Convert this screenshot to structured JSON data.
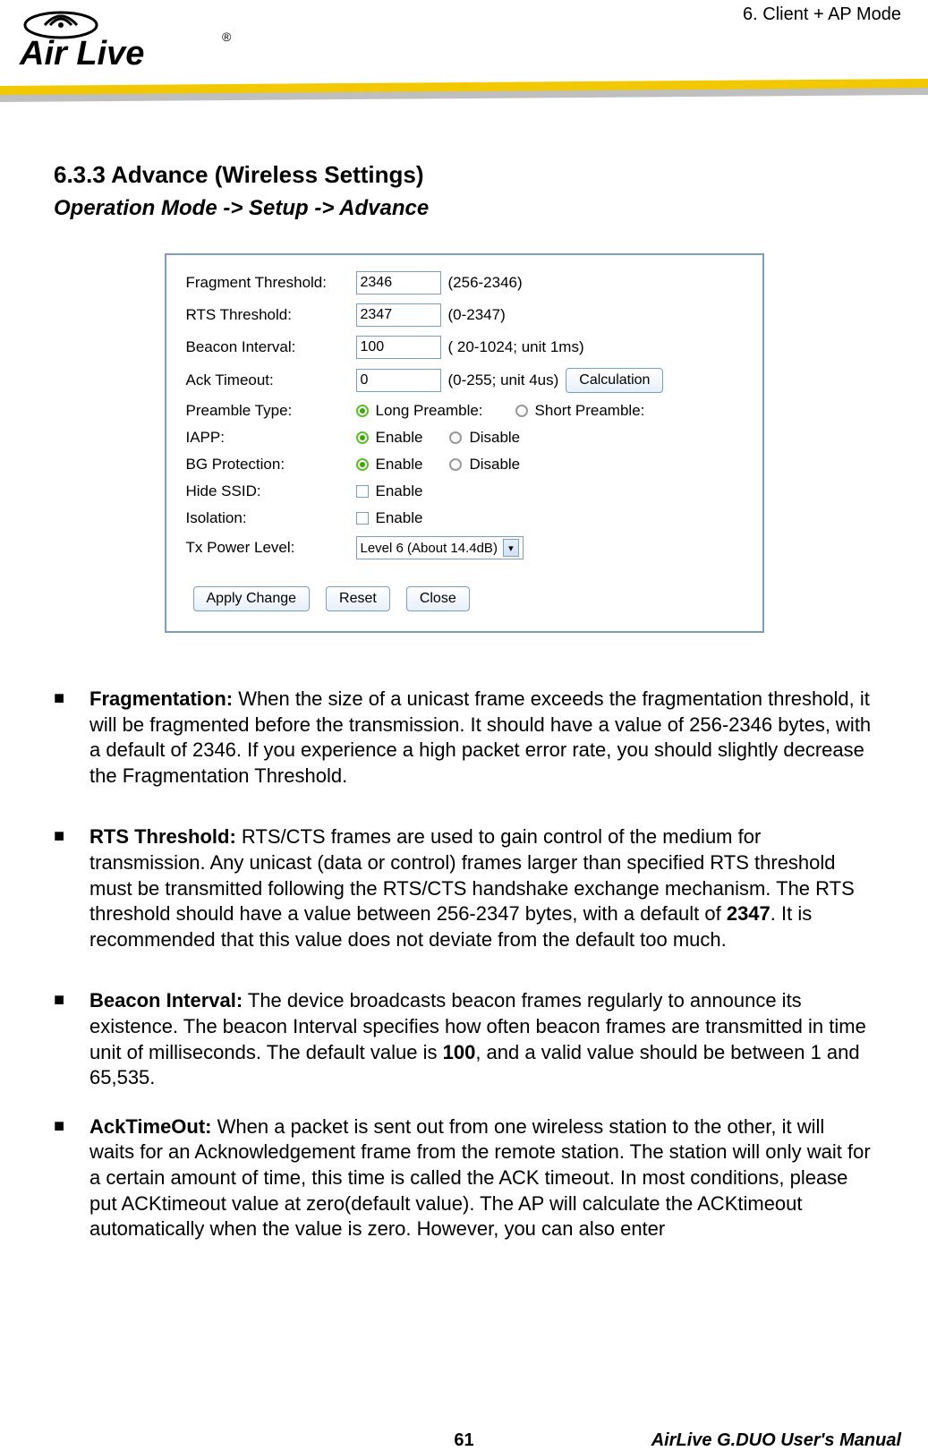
{
  "header": {
    "chapter": "6.   Client + AP Mode",
    "logo_text": "Air Live",
    "logo_sup": "®"
  },
  "section": {
    "title": "6.3.3 Advance (Wireless Settings)",
    "breadcrumb": "Operation Mode -> Setup -> Advance"
  },
  "dialog": {
    "fragment_threshold": {
      "label": "Fragment Threshold:",
      "value": "2346",
      "range": "(256-2346)"
    },
    "rts_threshold": {
      "label": "RTS Threshold:",
      "value": "2347",
      "range": "(0-2347)"
    },
    "beacon_interval": {
      "label": "Beacon Interval:",
      "value": "100",
      "range": "( 20-1024; unit 1ms)"
    },
    "ack_timeout": {
      "label": "Ack Timeout:",
      "value": "0",
      "range": "(0-255; unit 4us)"
    },
    "calculation_btn": "Calculation",
    "preamble_type": {
      "label": "Preamble Type:",
      "opt1": "Long Preamble:",
      "opt2": "Short Preamble:"
    },
    "iapp": {
      "label": "IAPP:",
      "opt1": "Enable",
      "opt2": "Disable"
    },
    "bg_protection": {
      "label": "BG Protection:",
      "opt1": "Enable",
      "opt2": "Disable"
    },
    "hide_ssid": {
      "label": "Hide SSID:",
      "opt": "Enable"
    },
    "isolation": {
      "label": "Isolation:",
      "opt": "Enable"
    },
    "tx_power": {
      "label": "Tx Power Level:",
      "selected": "Level 6 (About 14.4dB)"
    },
    "buttons": {
      "apply": "Apply Change",
      "reset": "Reset",
      "close": "Close"
    }
  },
  "bullets": {
    "fragmentation": {
      "title": "Fragmentation:",
      "body": " When the size of a unicast frame exceeds the fragmentation threshold, it will be fragmented before the transmission. It should have a value of 256-2346 bytes, with a default of 2346.   If you experience a high packet error rate, you should slightly decrease the Fragmentation Threshold."
    },
    "rts": {
      "title": "RTS Threshold:",
      "body_a": " RTS/CTS frames are used to gain control of the medium for transmission. Any unicast (data or control) frames larger than specified RTS threshold must be transmitted following the RTS/CTS handshake exchange mechanism. The RTS threshold should have a value between 256-2347 bytes, with a default of ",
      "bold": "2347",
      "body_b": ". It is recommended that this value does not deviate from the default too much."
    },
    "beacon": {
      "title": "Beacon Interval:",
      "body_a": " The device broadcasts beacon frames regularly to announce its existence. The beacon Interval specifies how often beacon frames are transmitted in time unit of milliseconds. The default value is ",
      "bold": "100",
      "body_b": ", and a valid value should be between 1 and 65,535."
    },
    "ack": {
      "title": "AckTimeOut:",
      "body": "  When a packet is sent out from one wireless station to the other, it will waits for an Acknowledgement frame from the remote station.   The station will only wait for a certain amount of time, this time is called the ACK timeout.   In most conditions, please put ACKtimeout value at zero(default value).   The AP will calculate the ACKtimeout automatically when the value is zero.   However, you can also enter"
    }
  },
  "footer": {
    "page": "61",
    "manual": "AirLive G.DUO User's Manual"
  }
}
